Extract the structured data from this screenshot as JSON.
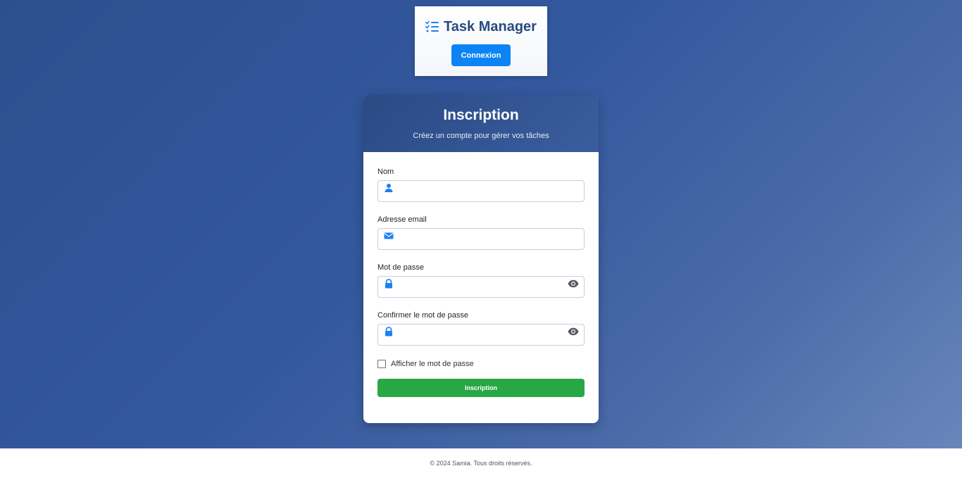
{
  "header": {
    "brand_title": "Task Manager",
    "login_button": "Connexion"
  },
  "form": {
    "title": "Inscription",
    "subtitle": "Créez un compte pour gérer vos tâches",
    "fields": [
      {
        "label": "Nom",
        "icon": "user-icon",
        "value": "",
        "placeholder": ""
      },
      {
        "label": "Adresse email",
        "icon": "envelope-icon",
        "value": "",
        "placeholder": ""
      },
      {
        "label": "Mot de passe",
        "icon": "lock-icon",
        "value": "",
        "placeholder": ""
      },
      {
        "label": "Confirmer le mot de passe",
        "icon": "lock-icon",
        "value": "",
        "placeholder": ""
      }
    ],
    "show_password_label": "Afficher le mot de passe",
    "show_password_checked": false,
    "submit_button": "Inscription"
  },
  "footer": {
    "text": "© 2024 Samia. Tous droits réservés."
  },
  "colors": {
    "accent": "#0d84f5",
    "success": "#28a745",
    "header_dark": "#274a80",
    "background": "#34589e"
  }
}
